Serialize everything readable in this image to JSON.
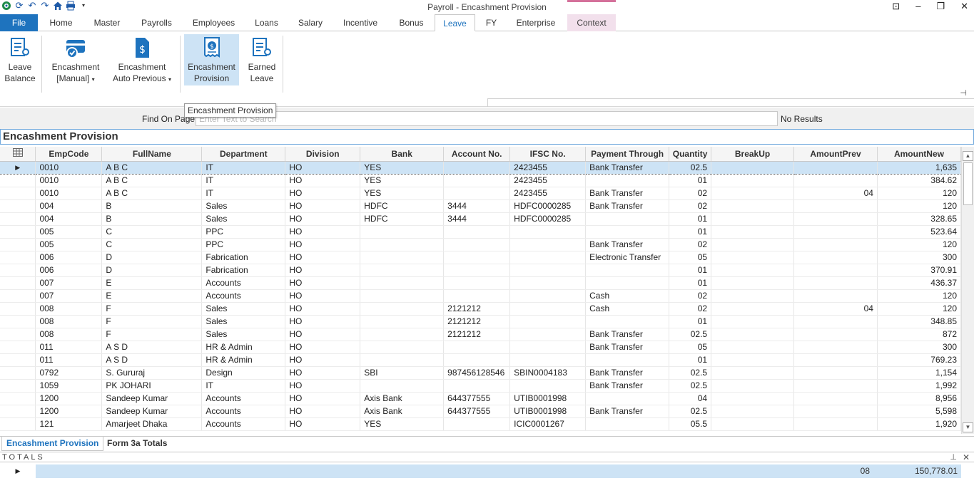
{
  "window": {
    "title": "Payroll - Encashment Provision"
  },
  "tabs": {
    "file": "File",
    "home": "Home",
    "master": "Master",
    "payrolls": "Payrolls",
    "employees": "Employees",
    "loans": "Loans",
    "salary": "Salary",
    "incentive": "Incentive",
    "bonus": "Bonus",
    "leave": "Leave",
    "fy": "FY",
    "enterprise": "Enterprise",
    "context": "Context"
  },
  "ribbon": {
    "leave_balance": [
      "Leave",
      "Balance"
    ],
    "encashment_manual": [
      "Encashment",
      "[Manual]"
    ],
    "encashment_auto": [
      "Encashment",
      "Auto Previous"
    ],
    "encashment_provision": [
      "Encashment",
      "Provision"
    ],
    "earned_leave": [
      "Earned",
      "Leave"
    ]
  },
  "tooltip": "Encashment Provision",
  "find": {
    "label": "Find On Page",
    "placeholder": "Enter Text to Search",
    "value": "",
    "result": "No Results"
  },
  "grid": {
    "title": "Encashment Provision",
    "columns": [
      "EmpCode",
      "FullName",
      "Department",
      "Division",
      "Bank",
      "Account No.",
      "IFSC No.",
      "Payment Through",
      "Quantity",
      "BreakUp",
      "AmountPrev",
      "AmountNew"
    ],
    "rows": [
      [
        "0010",
        "A B C",
        "IT",
        "HO",
        "YES",
        "",
        "2423455",
        "Bank Transfer",
        "02.5",
        "",
        "",
        "1,635"
      ],
      [
        "0010",
        "A B C",
        "IT",
        "HO",
        "YES",
        "",
        "2423455",
        "",
        "01",
        "",
        "",
        "384.62"
      ],
      [
        "0010",
        "A B C",
        "IT",
        "HO",
        "YES",
        "",
        "2423455",
        "Bank Transfer",
        "02",
        "",
        "04",
        "120"
      ],
      [
        "004",
        "B",
        "Sales",
        "HO",
        "HDFC",
        "3444",
        "HDFC0000285",
        "Bank Transfer",
        "02",
        "",
        "",
        "120"
      ],
      [
        "004",
        "B",
        "Sales",
        "HO",
        "HDFC",
        "3444",
        "HDFC0000285",
        "",
        "01",
        "",
        "",
        "328.65"
      ],
      [
        "005",
        "C",
        "PPC",
        "HO",
        "",
        "",
        "",
        "",
        "01",
        "",
        "",
        "523.64"
      ],
      [
        "005",
        "C",
        "PPC",
        "HO",
        "",
        "",
        "",
        "Bank Transfer",
        "02",
        "",
        "",
        "120"
      ],
      [
        "006",
        "D",
        "Fabrication",
        "HO",
        "",
        "",
        "",
        "Electronic Transfer",
        "05",
        "",
        "",
        "300"
      ],
      [
        "006",
        "D",
        "Fabrication",
        "HO",
        "",
        "",
        "",
        "",
        "01",
        "",
        "",
        "370.91"
      ],
      [
        "007",
        "E",
        "Accounts",
        "HO",
        "",
        "",
        "",
        "",
        "01",
        "",
        "",
        "436.37"
      ],
      [
        "007",
        "E",
        "Accounts",
        "HO",
        "",
        "",
        "",
        "Cash",
        "02",
        "",
        "",
        "120"
      ],
      [
        "008",
        "F",
        "Sales",
        "HO",
        "",
        "2121212",
        "",
        "Cash",
        "02",
        "",
        "04",
        "120"
      ],
      [
        "008",
        "F",
        "Sales",
        "HO",
        "",
        "2121212",
        "",
        "",
        "01",
        "",
        "",
        "348.85"
      ],
      [
        "008",
        "F",
        "Sales",
        "HO",
        "",
        "2121212",
        "",
        "Bank Transfer",
        "02.5",
        "",
        "",
        "872"
      ],
      [
        "011",
        "A S D",
        "HR & Admin",
        "HO",
        "",
        "",
        "",
        "Bank Transfer",
        "05",
        "",
        "",
        "300"
      ],
      [
        "011",
        "A S D",
        "HR & Admin",
        "HO",
        "",
        "",
        "",
        "",
        "01",
        "",
        "",
        "769.23"
      ],
      [
        "0792",
        "S. Gururaj",
        "Design",
        "HO",
        "SBI",
        "987456128546",
        "SBIN0004183",
        "Bank Transfer",
        "02.5",
        "",
        "",
        "1,154"
      ],
      [
        "1059",
        "PK JOHARI",
        "IT",
        "HO",
        "",
        "",
        "",
        "Bank Transfer",
        "02.5",
        "",
        "",
        "1,992"
      ],
      [
        "1200",
        "Sandeep  Kumar",
        "Accounts",
        "HO",
        "Axis Bank",
        "644377555",
        "UTIB0001998",
        "",
        "04",
        "",
        "",
        "8,956"
      ],
      [
        "1200",
        "Sandeep  Kumar",
        "Accounts",
        "HO",
        "Axis Bank",
        "644377555",
        "UTIB0001998",
        "Bank Transfer",
        "02.5",
        "",
        "",
        "5,598"
      ],
      [
        "121",
        "Amarjeet Dhaka",
        "Accounts",
        "HO",
        "YES",
        "",
        "ICIC0001267",
        "",
        "05.5",
        "",
        "",
        "1,920"
      ]
    ]
  },
  "bottom_tabs": {
    "encashment": "Encashment Provision",
    "form3a": "Form 3a Totals"
  },
  "totals": {
    "label": "TOTALS",
    "quantity": "08",
    "amount": "150,778.01"
  },
  "colors": {
    "accent": "#1e73be",
    "selection": "#cde3f5",
    "context_tab": "#f2e0ec"
  }
}
